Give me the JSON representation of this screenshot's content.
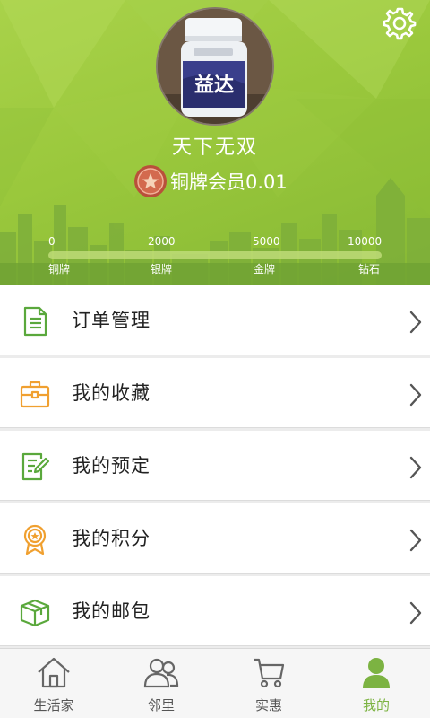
{
  "profile": {
    "username": "天下无双",
    "member_text": "铜牌会员0.01"
  },
  "levels": [
    {
      "value": "0",
      "name": "铜牌"
    },
    {
      "value": "2000",
      "name": "银牌"
    },
    {
      "value": "5000",
      "name": "金牌"
    },
    {
      "value": "10000",
      "name": "钻石"
    }
  ],
  "progress_fraction": 0.0,
  "menu": {
    "items": [
      {
        "label": "订单管理",
        "icon": "order-document-icon"
      },
      {
        "label": "我的收藏",
        "icon": "briefcase-icon"
      },
      {
        "label": "我的预定",
        "icon": "edit-document-icon"
      },
      {
        "label": "我的积分",
        "icon": "award-ribbon-icon"
      },
      {
        "label": "我的邮包",
        "icon": "package-box-icon"
      }
    ]
  },
  "tabs": [
    {
      "label": "生活家",
      "icon": "home-icon",
      "active": false
    },
    {
      "label": "邻里",
      "icon": "neighbors-icon",
      "active": false
    },
    {
      "label": "实惠",
      "icon": "cart-icon",
      "active": false
    },
    {
      "label": "我的",
      "icon": "user-icon",
      "active": true
    }
  ],
  "colors": {
    "header_green": "#9ac83c",
    "accent_green": "#7cb342",
    "menu_icon_green": "#5aa83c",
    "menu_icon_orange": "#f0a030"
  }
}
